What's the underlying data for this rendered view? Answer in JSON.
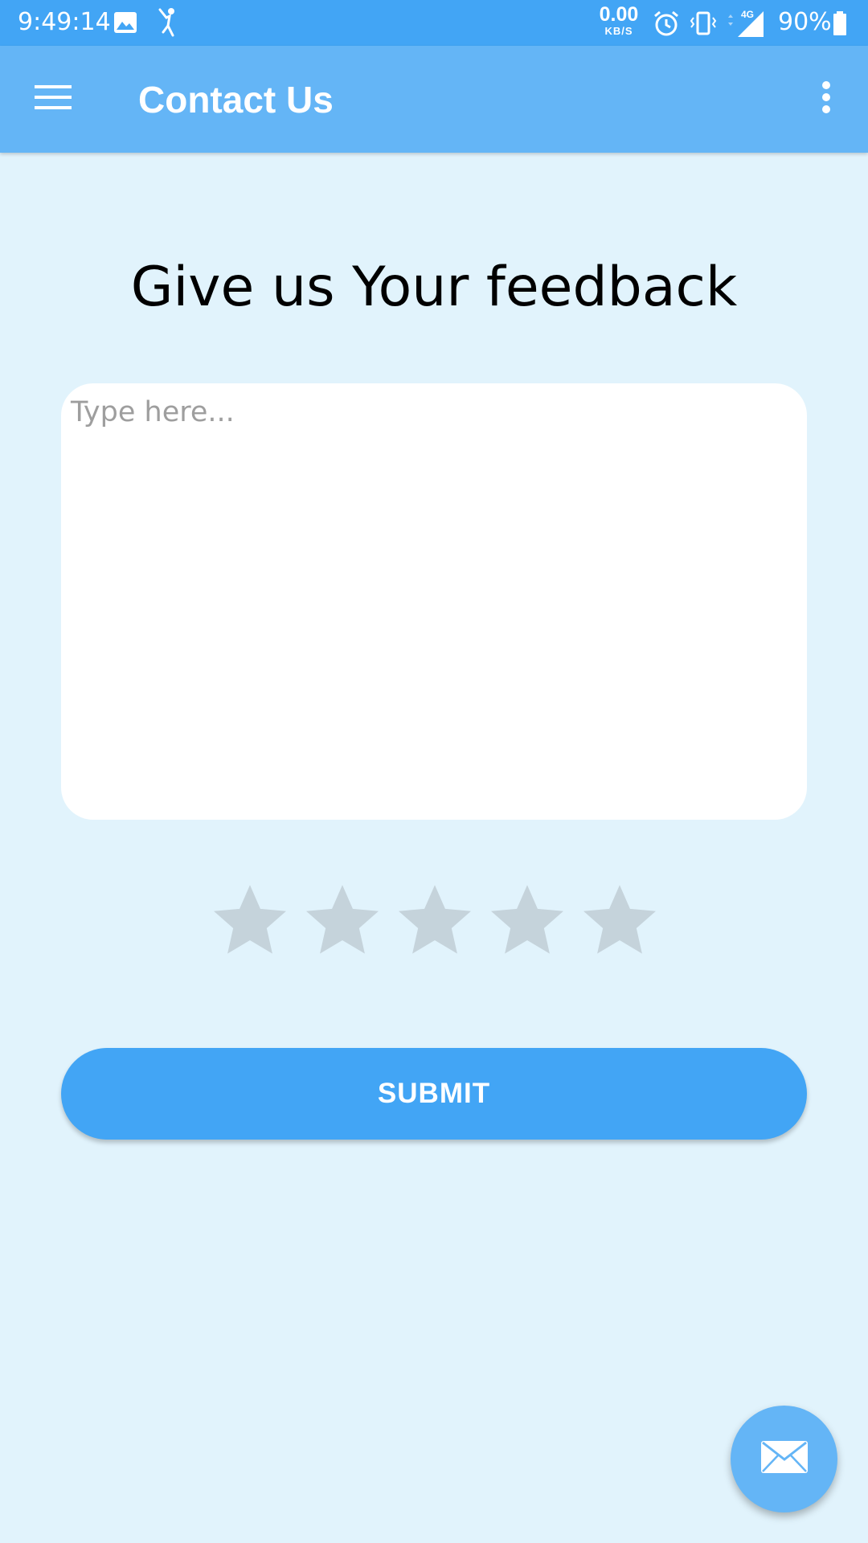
{
  "status_bar": {
    "time": "9:49:14",
    "net_speed_value": "0.00",
    "net_speed_unit": "KB/S",
    "network_type": "4G",
    "battery_percent": "90%",
    "icons": [
      "gallery-icon",
      "app-notification-icon",
      "alarm-icon",
      "vibrate-icon",
      "signal-icon",
      "battery-icon"
    ]
  },
  "app_bar": {
    "title": "Contact Us",
    "left_icon": "menu-icon",
    "right_icon": "more-vert-icon"
  },
  "main": {
    "heading": "Give us Your feedback",
    "feedback_input": {
      "value": "",
      "placeholder": "Type here..."
    },
    "rating": {
      "value": 0,
      "max": 5
    },
    "submit_label": "SUBMIT"
  },
  "fab": {
    "icon": "mail-icon"
  },
  "colors": {
    "status_bar": "#42a5f5",
    "app_bar": "#64b5f6",
    "background": "#e1f3fc",
    "accent": "#42a5f5",
    "star_empty": "#c5d3db"
  }
}
